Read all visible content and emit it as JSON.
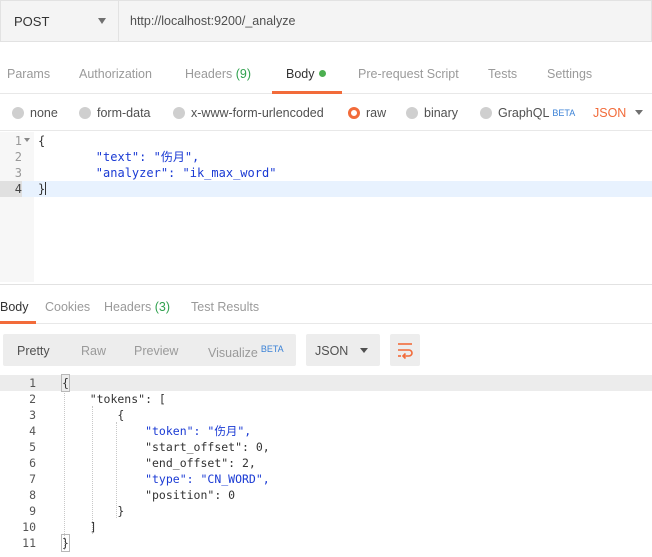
{
  "request": {
    "method": "POST",
    "url": "http://localhost:9200/_analyze"
  },
  "request_tabs": [
    {
      "label": "Params"
    },
    {
      "label": "Authorization"
    },
    {
      "label": "Headers",
      "count": "(9)"
    },
    {
      "label": "Body"
    },
    {
      "label": "Pre-request Script"
    },
    {
      "label": "Tests"
    },
    {
      "label": "Settings"
    }
  ],
  "body_types": [
    {
      "label": "none"
    },
    {
      "label": "form-data"
    },
    {
      "label": "x-www-form-urlencoded"
    },
    {
      "label": "raw"
    },
    {
      "label": "binary"
    },
    {
      "label": "GraphQL",
      "badge": "BETA"
    }
  ],
  "body_language": "JSON",
  "request_body_lines": [
    {
      "n": "1",
      "text": "{"
    },
    {
      "n": "2",
      "text": "    \"text\": \"伤月\","
    },
    {
      "n": "3",
      "text": "    \"analyzer\": \"ik_max_word\""
    },
    {
      "n": "4",
      "text": "}"
    }
  ],
  "response_tabs": [
    {
      "label": "Body"
    },
    {
      "label": "Cookies"
    },
    {
      "label": "Headers",
      "count": "(3)"
    },
    {
      "label": "Test Results"
    }
  ],
  "response_views": [
    {
      "label": "Pretty"
    },
    {
      "label": "Raw"
    },
    {
      "label": "Preview"
    },
    {
      "label": "Visualize",
      "badge": "BETA"
    }
  ],
  "response_format": "JSON",
  "response_lines": [
    {
      "n": "1",
      "text": "{"
    },
    {
      "n": "2",
      "text": "    \"tokens\": ["
    },
    {
      "n": "3",
      "text": "        {"
    },
    {
      "n": "4",
      "text": "            \"token\": \"伤月\","
    },
    {
      "n": "5",
      "text": "            \"start_offset\": 0,"
    },
    {
      "n": "6",
      "text": "            \"end_offset\": 2,"
    },
    {
      "n": "7",
      "text": "            \"type\": \"CN_WORD\","
    },
    {
      "n": "8",
      "text": "            \"position\": 0"
    },
    {
      "n": "9",
      "text": "        }"
    },
    {
      "n": "10",
      "text": "    ]"
    },
    {
      "n": "11",
      "text": "}"
    }
  ],
  "icons": {
    "method_dropdown": "chevron-down-icon",
    "format_dropdown": "chevron-down-icon",
    "wrap": "wrap-lines-icon"
  },
  "colors": {
    "accent": "#f26b3a",
    "count": "#30a14e",
    "badge": "#3b82d6",
    "string": "#1a3ad4"
  }
}
